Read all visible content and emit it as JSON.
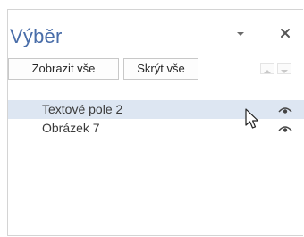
{
  "pane": {
    "title": "Výběr",
    "menu_icon": "chevron-down-icon",
    "close_icon": "close-icon"
  },
  "toolbar": {
    "show_all_label": "Zobrazit vše",
    "hide_all_label": "Skrýt vše",
    "move_up_icon": "triangle-up-icon",
    "move_down_icon": "triangle-down-icon"
  },
  "items": [
    {
      "label": "Textové pole 2",
      "selected": true,
      "visibility_icon": "eye-icon"
    },
    {
      "label": "Obrázek 7",
      "selected": false,
      "visibility_icon": "eye-icon"
    }
  ],
  "colors": {
    "title": "#4a6ea9",
    "selection": "#dde6f2"
  }
}
